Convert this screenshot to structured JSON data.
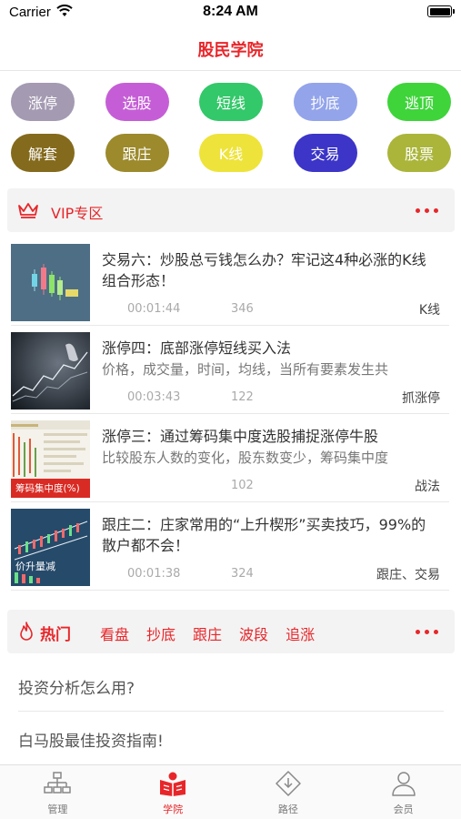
{
  "status": {
    "carrier": "Carrier",
    "time": "8:24 AM"
  },
  "nav": {
    "title": "股民学院"
  },
  "categories": [
    {
      "label": "涨停",
      "color": "#a49ab2"
    },
    {
      "label": "选股",
      "color": "#c55ed6"
    },
    {
      "label": "短线",
      "color": "#33c86a"
    },
    {
      "label": "抄底",
      "color": "#93a4ea"
    },
    {
      "label": "逃顶",
      "color": "#3ed43a"
    },
    {
      "label": "解套",
      "color": "#846a1c"
    },
    {
      "label": "跟庄",
      "color": "#9c8a2c"
    },
    {
      "label": "K线",
      "color": "#eee33a"
    },
    {
      "label": "交易",
      "color": "#3c35c8"
    },
    {
      "label": "股票",
      "color": "#aab53a"
    }
  ],
  "vip": {
    "title": "VIP专区"
  },
  "courses": [
    {
      "title": "交易六：炒股总亏钱怎么办？牢记这4种必涨的K线组合形态！",
      "desc": "",
      "duration": "00:01:44",
      "views": "346",
      "tag": "K线"
    },
    {
      "title": "涨停四：底部涨停短线买入法",
      "desc": "价格，成交量，时间，均线，当所有要素发生共",
      "duration": "00:03:43",
      "views": "122",
      "tag": "抓涨停"
    },
    {
      "title": "涨停三：通过筹码集中度选股捕捉涨停牛股",
      "desc": "比较股东人数的变化，股东数变少，筹码集中度",
      "duration": "",
      "views": "102",
      "tag": "战法",
      "thumb_caption": "筹码集中度(%)"
    },
    {
      "title": "跟庄二：庄家常用的“上升楔形”买卖技巧，99%的散户都不会！",
      "desc": "",
      "duration": "00:01:38",
      "views": "324",
      "tag": "跟庄、交易",
      "thumb_caption": "价升量减"
    }
  ],
  "hot": {
    "title": "热门",
    "tags": [
      "看盘",
      "抄底",
      "跟庄",
      "波段",
      "追涨"
    ]
  },
  "hot_items": [
    "投资分析怎么用?",
    "白马股最佳投资指南!"
  ],
  "tabs": [
    {
      "label": "管理",
      "icon": "org-chart-icon"
    },
    {
      "label": "学院",
      "icon": "book-icon"
    },
    {
      "label": "路径",
      "icon": "download-diamond-icon"
    },
    {
      "label": "会员",
      "icon": "person-icon"
    }
  ],
  "colors": {
    "accent": "#e8262a"
  }
}
